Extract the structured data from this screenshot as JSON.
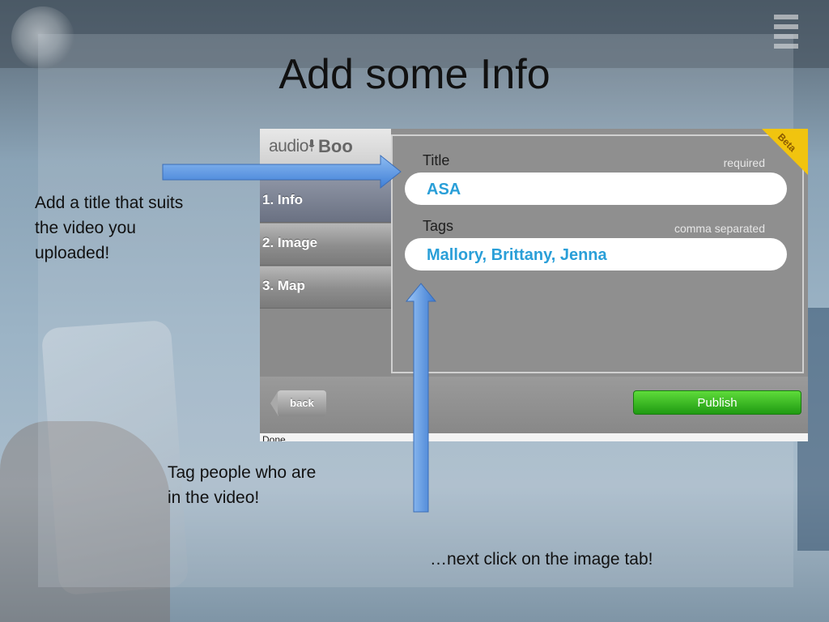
{
  "slide": {
    "title": "Add some Info",
    "captions": {
      "title_tip": [
        "Add a title that suits",
        "the video you",
        "uploaded!"
      ],
      "tags_tip": [
        "Tag people who are",
        "in the video!"
      ],
      "next_tip": "…next click on the image tab!"
    }
  },
  "app": {
    "logo": {
      "prefix": "audio",
      "suffix": "Boo"
    },
    "badge": "Beta",
    "nav": [
      {
        "label": "1. Info",
        "active": true
      },
      {
        "label": "2. Image",
        "active": false
      },
      {
        "label": "3. Map",
        "active": false
      }
    ],
    "form": {
      "title_label": "Title",
      "title_hint": "required",
      "title_value": "ASA",
      "tags_label": "Tags",
      "tags_hint": "comma separated",
      "tags_value": "Mallory, Brittany, Jenna"
    },
    "buttons": {
      "back": "back",
      "publish": "Publish"
    },
    "status": "Done"
  },
  "colors": {
    "arrow_blue": "#4f8ee0",
    "input_text": "#2a9fd8",
    "publish_green": "#2eb41e",
    "beta_yellow": "#f1c40f"
  }
}
